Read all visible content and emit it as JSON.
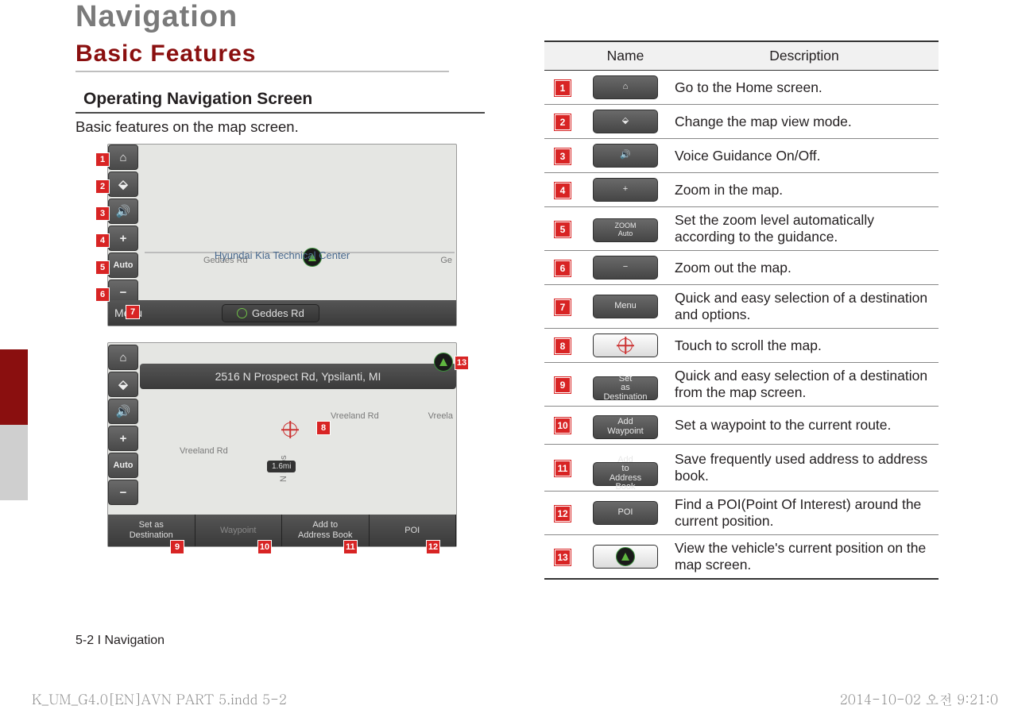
{
  "chapter_title": "Navigation",
  "section_title": "Basic Features",
  "subsection_title": "Operating Navigation Screen",
  "intro_text": "Basic features on the map screen.",
  "page_label": "5-2 I Navigation",
  "print_footer_left": "K_UM_G4.0[EN]AVN PART 5.indd   5-2",
  "print_footer_right": "2014-10-02   오전 9:21:0",
  "screenshot1": {
    "road1": "Geddes Rd",
    "road2": "Ge",
    "center_text": "Hyundai Kia Technical Center",
    "menu_label": "Menu",
    "route_label": "Geddes Rd"
  },
  "screenshot2": {
    "address": "2516 N Prospect Rd, Ypsilanti, MI",
    "road_a": "Vreeland Rd",
    "road_b": "Vreela",
    "road_c": "Vreeland Rd",
    "road_d": "N Pros",
    "distance": "1.6mi",
    "btn_set_dest": "Set as\nDestination",
    "btn_waypoint": "Waypoint",
    "btn_addrbook": "Add to\nAddress Book",
    "btn_poi": "POI"
  },
  "table": {
    "head_name": "Name",
    "head_desc": "Description",
    "rows": [
      {
        "n": "1",
        "icon": "home",
        "label": "",
        "desc": "Go to the Home screen."
      },
      {
        "n": "2",
        "icon": "viewmode",
        "label": "",
        "desc": "Change the map view mode."
      },
      {
        "n": "3",
        "icon": "voice",
        "label": "",
        "desc": "Voice Guidance On/Off."
      },
      {
        "n": "4",
        "icon": "plus",
        "label": "",
        "desc": "Zoom in the map."
      },
      {
        "n": "5",
        "icon": "autozoom",
        "label": "",
        "desc": "Set the zoom level automatically according to the guidance."
      },
      {
        "n": "6",
        "icon": "minus",
        "label": "",
        "desc": "Zoom out the map."
      },
      {
        "n": "7",
        "icon": "text",
        "label": "Menu",
        "desc": "Quick and easy selection of a destination and options."
      },
      {
        "n": "8",
        "icon": "crosshair",
        "label": "",
        "desc": "Touch to scroll the map."
      },
      {
        "n": "9",
        "icon": "text",
        "label": "Set as Destination",
        "desc": "Quick and easy selection of a destination from the map screen."
      },
      {
        "n": "10",
        "icon": "text",
        "label": "Add Waypoint",
        "desc": "Set a waypoint to the current route."
      },
      {
        "n": "11",
        "icon": "text",
        "label": "Add to Address Book",
        "desc": "Save frequently used address to address book."
      },
      {
        "n": "12",
        "icon": "text",
        "label": "POI",
        "desc": "Find a POI(Point Of Interest) around the current position."
      },
      {
        "n": "13",
        "icon": "greencompass",
        "label": "",
        "desc": "View the vehicle's current position on the map screen."
      }
    ]
  }
}
